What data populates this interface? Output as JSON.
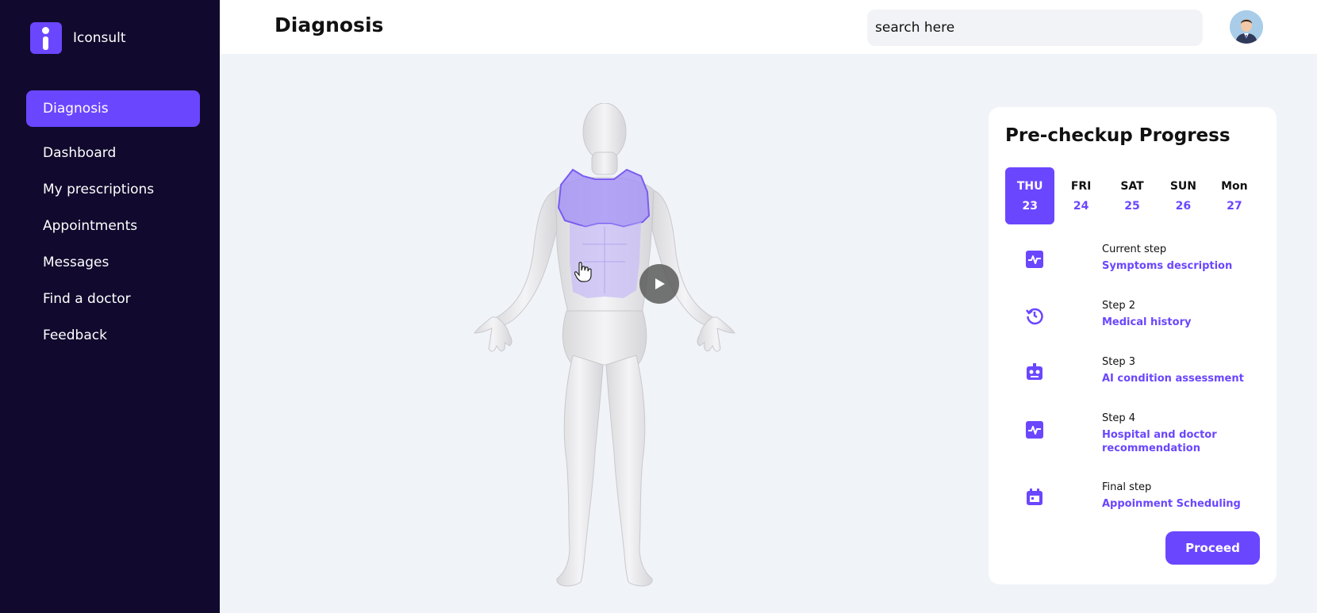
{
  "app": {
    "name": "Iconsult"
  },
  "sidebar": {
    "items": [
      {
        "label": "Diagnosis",
        "active": true
      },
      {
        "label": "Dashboard"
      },
      {
        "label": "My prescriptions"
      },
      {
        "label": "Appointments"
      },
      {
        "label": "Messages"
      },
      {
        "label": "Find a doctor"
      },
      {
        "label": "Feedback"
      }
    ]
  },
  "header": {
    "title": "Diagnosis",
    "search_placeholder": "search here"
  },
  "progress": {
    "title": "Pre-checkup Progress",
    "days": [
      {
        "name": "THU",
        "num": "23",
        "active": true
      },
      {
        "name": "FRI",
        "num": "24"
      },
      {
        "name": "SAT",
        "num": "25"
      },
      {
        "name": "SUN",
        "num": "26"
      },
      {
        "name": "Mon",
        "num": "27"
      }
    ],
    "steps": [
      {
        "label": "Current step",
        "value": "Symptoms description",
        "icon": "pulse-icon"
      },
      {
        "label": "Step 2",
        "value": "Medical history",
        "icon": "history-icon"
      },
      {
        "label": "Step 3",
        "value": "AI condition assessment",
        "icon": "robot-icon"
      },
      {
        "label": "Step 4",
        "value": "Hospital and doctor recommendation",
        "icon": "pulse-icon"
      },
      {
        "label": "Final step",
        "value": "Appoinment Scheduling",
        "icon": "calendar-icon"
      }
    ],
    "proceed_label": "Proceed"
  },
  "colors": {
    "accent": "#6b46ff",
    "sidebar_bg": "#110a2e",
    "page_bg": "#f0f3f8",
    "highlight": "#a895f5"
  }
}
